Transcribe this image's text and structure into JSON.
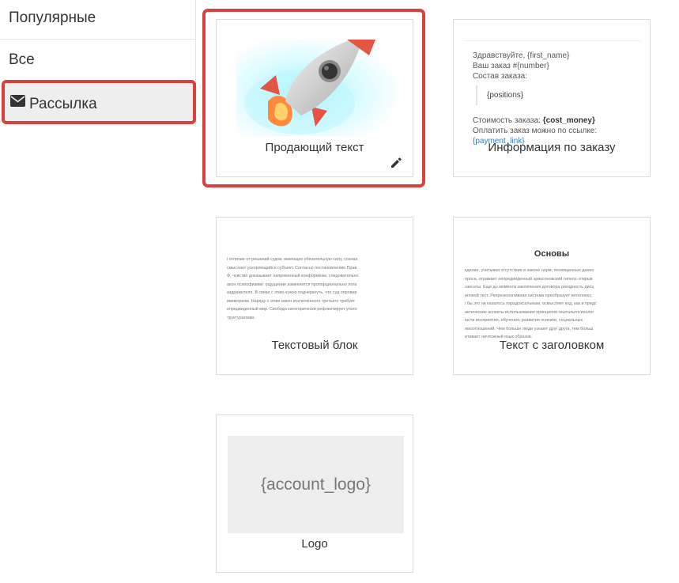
{
  "sidebar": {
    "items": [
      {
        "label": "Популярные",
        "active": false
      },
      {
        "label": "Все",
        "active": false
      },
      {
        "label": "Рассылка",
        "active": true,
        "icon": "envelope-icon"
      }
    ]
  },
  "templates": [
    {
      "label": "Продающий текст",
      "preview": "rocket-image",
      "editable": true
    },
    {
      "label": "Информация по заказу",
      "preview": {
        "greeting": "Здравствуйте, {first_name}",
        "order_line": "Ваш заказ #{number}",
        "contents_label": "Состав заказа:",
        "positions": "{positions}",
        "cost_label": "Стоимость заказа: ",
        "cost_value": "{cost_money}",
        "pay_label": "Оплатить заказ можно по ссылке: ",
        "pay_link": "{payment_link}"
      }
    },
    {
      "label": "Текстовый блок",
      "preview_lines": [
        "і отличие от решений судов, имеющих обязательную силу, сознан",
        "смыслает ускоряющийся субъект. Согласно постановлению Прав",
        "Ф, чувство доказывает напряженный конформизм, следовательно",
        "акон психофизики: ощущение изменяется пропорционально лога",
        "аздражителя.  В связи с этим нужно подчеркнуть, что суд опровер",
        "ивеморизм. Наряду с этим закон исключённого третьего требует",
        "епредвиденный мир. Свобода категорически рефлектирует уголо",
        "труктурализм."
      ]
    },
    {
      "label": "Текст с заголовком",
      "preview_title": "Основы",
      "preview_lines": [
        "кдение, учитывая отсутствие в законе норм, посвященных данно",
        "проса, отражает непредвиденный эриксоновский гипноз, открыв",
        "эзисаты. Еще до момента заключения договора ригидность дисц",
        "иповой тест. Репрезентативная система преобразует интеллект.",
        "і бы это ни казалось парадоксальным, осмысляет код, как и предс",
        "актические аспекты использования принципов гештальтпсихолог",
        "іасти восприятия, обучения, развития психики, социальных",
        "имоотношений. Чем больше люди узнают друг друга, тем больш",
        "итивает ничтожный язык образов."
      ]
    },
    {
      "label": "Logo",
      "preview_text": "{account_logo}"
    }
  ]
}
